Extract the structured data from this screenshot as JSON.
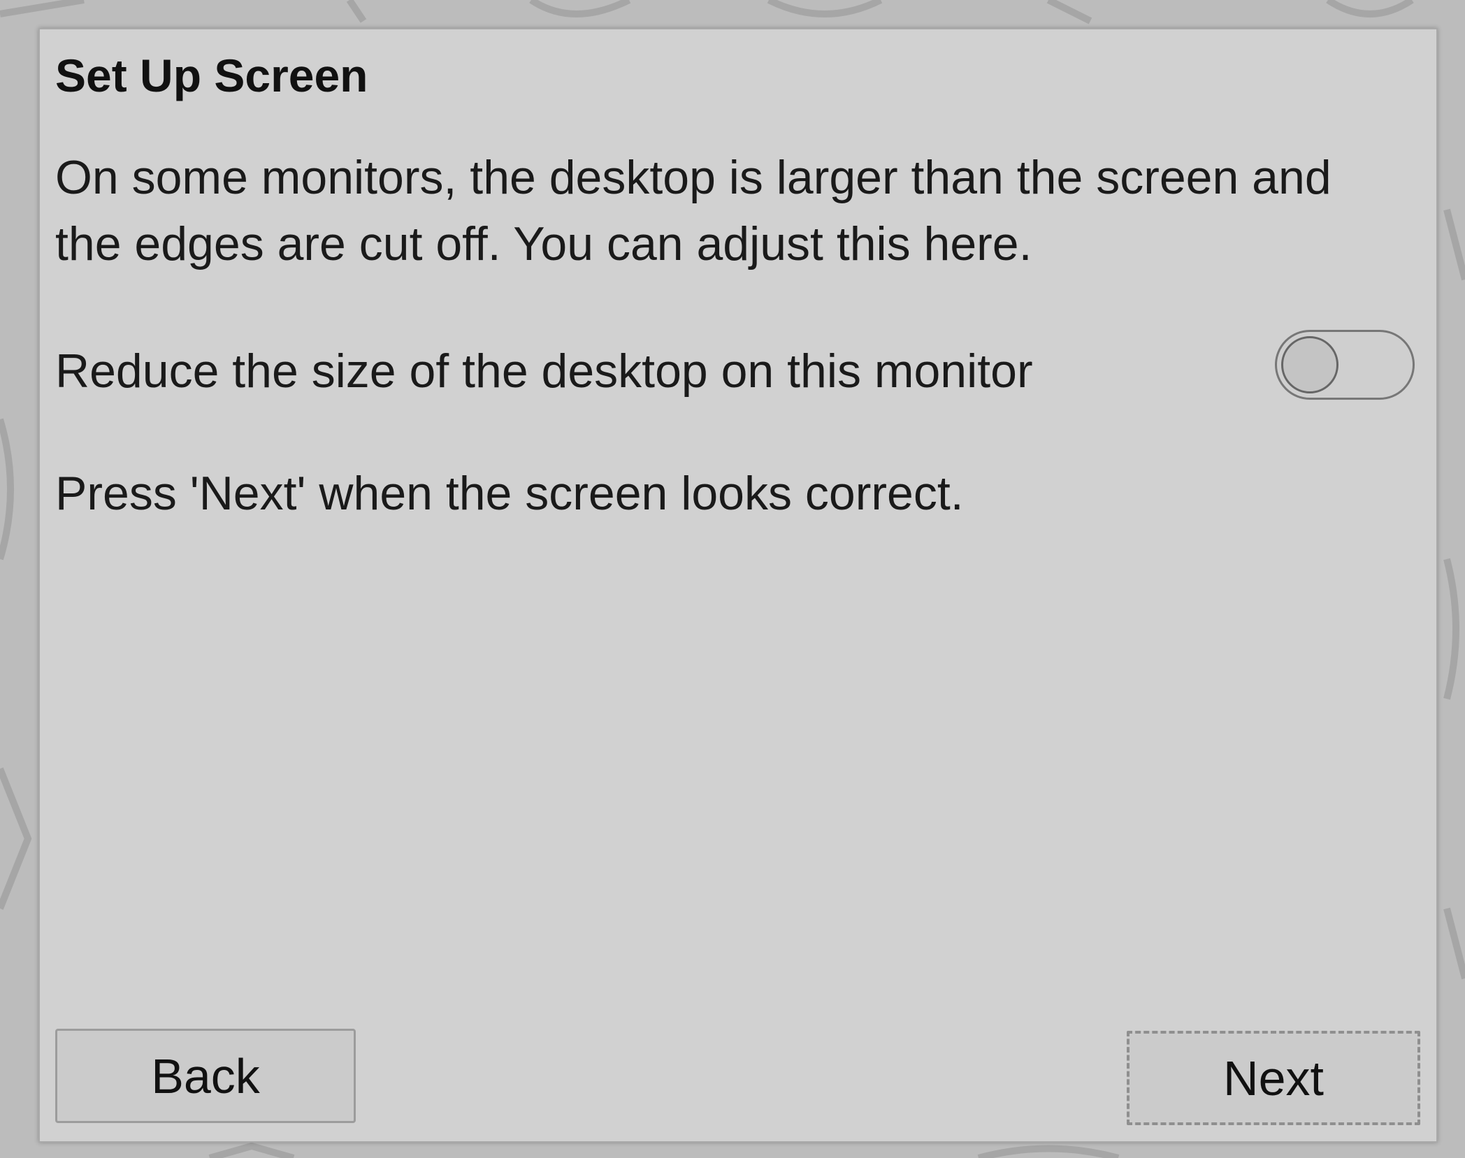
{
  "dialog": {
    "title": "Set Up Screen",
    "description": "On some monitors, the desktop is larger than the screen and the edges are cut off. You can adjust this here.",
    "option": {
      "label": "Reduce the size of the desktop on this monitor",
      "enabled": false
    },
    "hint": "Press 'Next' when the screen looks correct.",
    "buttons": {
      "back_label": "Back",
      "next_label": "Next"
    }
  }
}
